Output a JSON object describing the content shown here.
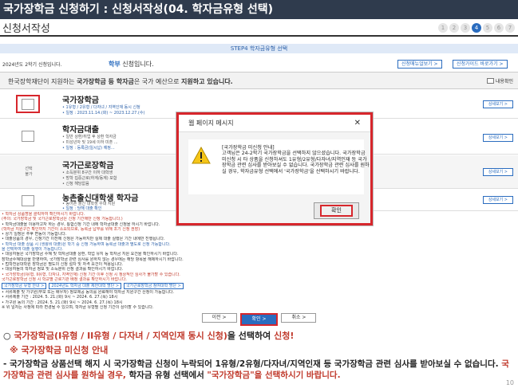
{
  "header": {
    "title": "국가장학금 신청하기 : 신청서작성(04. 학자금유형 선택)",
    "subtitle": "신청서작성",
    "steps": [
      "1",
      "2",
      "3",
      "4",
      "5",
      "6",
      "7"
    ],
    "active_step": 4
  },
  "step_bar": {
    "label": "STEP4 학자금유형 선택"
  },
  "year_line": {
    "small": "2024년도 2학기 신청입니다.",
    "text_prefix": "학부",
    "text_suffix": "신청입니다."
  },
  "header_buttons": {
    "manual": "신청매뉴얼보기 >",
    "guide": "신청가이드 바로가기 >"
  },
  "notice_panel": {
    "text_pre": "한국장학재단이 지원하는 ",
    "text_bold1": "국가장학금 등 학자금",
    "text_mid": "은 국가 예산으로 ",
    "text_bold2": "지원하고 있습니다.",
    "checkbox_label": "내용확인"
  },
  "rows": [
    {
      "title": "국가장학금",
      "lines": [
        "• 1유형 / 2유형 / 다자녀 / 지역인재 동시 신청",
        "• 일정 : 2023.11.14.(화) ~ 2023.12.27.(수)"
      ],
      "detail": "상세보기 >"
    },
    {
      "title": "학자금대출",
      "lines": [
        "• 일반 상환/취업 후 상환 학자금",
        "• 미성년자 및 19세 이하 미혼 ...",
        "• 일정 : 등록금(일시납) 예정..."
      ],
      "detail": "상세보기 >"
    },
    {
      "side": "선택\n불가",
      "title": "국가근로장학금",
      "lines": [
        "• 소득분위 8구간 이하 대학생",
        "• 방학 집중근로(하계/동계) 포함",
        "• 신청 해당없음"
      ],
      "detail": "상세보기 >"
    },
    {
      "title": "농촌출신대학생 학자금",
      "lines": [
        "• 농어촌 출신 대학생 우대 지원",
        "• 일정 : 당해 대출 확인"
      ],
      "detail": "상세보기 >"
    }
  ],
  "notes": [
    "• 학자금 상품명을 클릭하여 확인하시기 바랍니다.",
    "  (주의: 국가장학금 및 국가근로장학금은 신청 기간에만 신청 가능합니다.)",
    "• 학자금대출을 이용하고자 하는 경우, 통합신청 기간 내에 학자금대출 신청을 하시기 바랍니다.",
    "  (학자금 지원구간 확인까지 기간이 소요되므로, 등록금 납부를 위해 조기 신청 권장)",
    "• 상기 일정은 추후 변동이 가능합니다.",
    "• 대출상품의 경우, 신청기간 이전에 신청은 가능하지만 실제 대출 실행은 기간 내에만 진행됩니다.",
    "• 학자금 대출 상품 시 (생활비 대출)은 학기 중 신청 가능하며 등록금 대출과 별도로 신청 가능합니다.",
    "  을 선택하여 대출 실행이 가능합니다.",
    "• 대상자들은 국가장학금 수혜 및 학자금대출 상환, 학업 유지 등 학자금 지원 요건을 확인하시기 바랍니다.",
    "  장학금수혜대상을 반영하여, 국가장학금 관련 심사를 원하지 않는 경우에는 해당 항목을 해제하시기 바랍니다.",
    "• 법학전문대학원 장학금은 별도의 신청 절차 및 자격 요건이 적용됩니다.",
    "• 대상자들의 학자금 정보 및 소득분위 산정 결과를 확인하시기 바랍니다.",
    "• 국가장학금(I유형, II유형, 다자녀, 지역인재) 신청 기간 이후 신청 시 정상적인 심사가 불가할 수 있습니다.",
    "  국가근로장학금 신청 시 학교별 근로기관 배정 결과를 확인하시기 바랍니다."
  ],
  "note_buttons": [
    "국가장학금 유형 안내 >",
    "2024년도 학자금 대출 제한대학 명단 >",
    "국가근로장학금 참여대학 명단 >"
  ],
  "notes2": [
    "• 서류제출 및 가구원(부모 또는 배우자) 정보제공 동의를 완료해야 학자금 지원구간 산정이 가능합니다.",
    "• 서류제출 기간 : 2024. 5. 21.(화) 9시 ~ 2024. 6. 27.(목) 18시",
    "• 가구원 동의 기간 : 2024. 5. 21.(화) 9시 ~ 2024. 6. 27.(목) 18시",
    "  ※ 위 일자는 사정에 따라 변경될 수 있으며, 학자금 유형별 신청 기간이 상이할 수 있습니다."
  ],
  "bottom_buttons": {
    "prev": "이전 >",
    "confirm": "확인 >",
    "cancel": "취소 >"
  },
  "dialog": {
    "title": "웹 페이지 메시지",
    "close": "✕",
    "message": "[국가장학금 미신청 안내]\n고객님은 24-2학기 국가장학금을 선택하지 않으셨습니다. 국가장학금 미신청 시 타 상품을 신청하셔도 1유형/2유형/다자녀/지역인재 등 국가장학금 관련 심사를 받아보실 수 없습니다. 국가장학금 관련 심사를 원하실 경우, 학자금유형 선택에서 '국가장학금'을 선택하시기 바랍니다.",
    "ok": "확인"
  },
  "caption": {
    "line1_bullet": "○ ",
    "line1_orange": "국가장학금(I유형 / II유형 / 다자녀 / 지역인재 동시 신청)",
    "line1_mid": "을 선택하여 ",
    "line1_end": "신청!",
    "line2": "※ 국가장학금 미신청 안내",
    "line3_a": "- 국가장학금 상품선택 해지 시 국가장학금 신청이 누락되어 1유형/2유형/다자녀/지역인재 등 국가장학금 관련 심사를 받아보실 수 없습니다. ",
    "line3_orange": "국가장학금 관련 심사를 원하실 경우,",
    "line3_b": " 학자금 유형 선택에서 ",
    "line3_orange2": "\"국가장학금\"을 선택하시기 바랍니다."
  },
  "page_number": "10",
  "colors": {
    "accent": "#2a6cbf",
    "highlight": "#d7262c",
    "topbar": "#2f3b4d"
  }
}
